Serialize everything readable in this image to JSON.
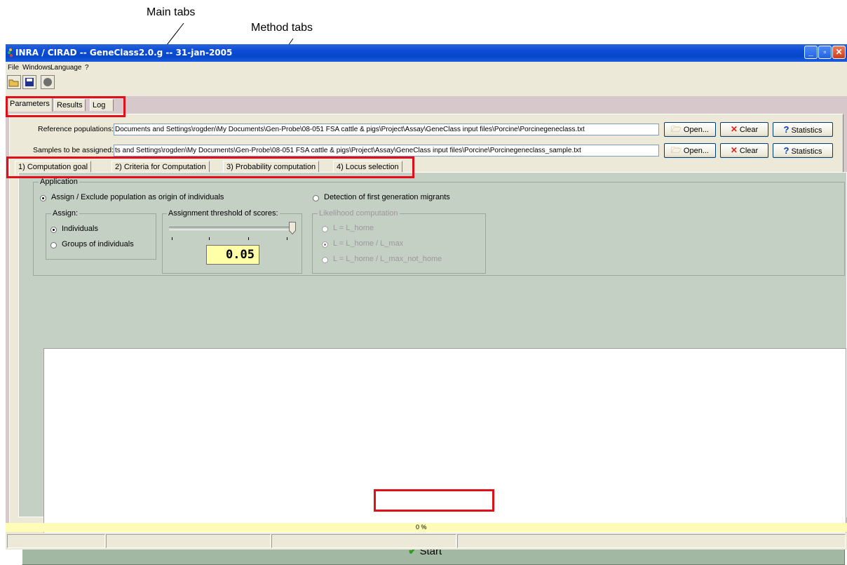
{
  "annotations": {
    "main_tabs_label": "Main tabs",
    "method_tabs_label": "Method tabs"
  },
  "window": {
    "title": "INRA / CIRAD  --  GeneClass2.0.g  --  31-jan-2005",
    "controls": [
      "minimize-icon",
      "restore-icon",
      "close-icon"
    ]
  },
  "menu": {
    "items": [
      {
        "label": "File"
      },
      {
        "label": "Windows"
      },
      {
        "label": "Language"
      },
      {
        "label": "?"
      }
    ]
  },
  "toolbar": {
    "buttons": [
      "open-folder-icon",
      "save-icon",
      "record-icon"
    ]
  },
  "main_tabs": [
    {
      "label": "Parameters",
      "active": true
    },
    {
      "label": "Results",
      "active": false
    },
    {
      "label": "Log",
      "active": false
    }
  ],
  "files": {
    "reference": {
      "label": "Reference populations:",
      "value": "Documents and Settings\\rogden\\My Documents\\Gen-Probe\\08-051 FSA cattle & pigs\\Project\\Assay\\GeneClass input files\\Porcine\\Porcinegeneclass.txt",
      "open_label": "Open...",
      "clear_label": "Clear",
      "stats_label": "Statistics"
    },
    "samples": {
      "label": "Samples to be assigned:",
      "value": "ts and Settings\\rogden\\My Documents\\Gen-Probe\\08-051 FSA cattle & pigs\\Project\\Assay\\GeneClass input files\\Porcine\\Porcinegeneclass_sample.txt",
      "open_label": "Open...",
      "clear_label": "Clear",
      "stats_label": "Statistics"
    }
  },
  "method_tabs": [
    {
      "label": "1) Computation goal",
      "active": true
    },
    {
      "label": "2) Criteria for Computation",
      "active": false
    },
    {
      "label": "3) Probability computation",
      "active": false
    },
    {
      "label": "4) Locus selection",
      "active": false
    }
  ],
  "application": {
    "title": "Application",
    "assign_exclude_label": "Assign / Exclude population as origin of individuals",
    "assign_exclude_selected": true,
    "migrants_label": "Detection of first generation migrants",
    "migrants_selected": false,
    "assign": {
      "title": "Assign:",
      "individuals_label": "Individuals",
      "individuals_selected": true,
      "groups_label": "Groups of individuals",
      "groups_selected": false
    },
    "threshold": {
      "title": "Assignment threshold of scores:",
      "value": "0.05",
      "slider_fraction": 1.0
    },
    "likelihood": {
      "title": "Likelihood computation",
      "options": [
        {
          "label": "L = L_home",
          "selected": false
        },
        {
          "label": "L = L_home / L_max",
          "selected": true
        },
        {
          "label": "L = L_home / L_max_not_home",
          "selected": false
        }
      ]
    }
  },
  "start_label": "Start",
  "progress_text": "0 %",
  "colors": {
    "highlight_box": "#e0101a",
    "titlebar": "#0a4bd6",
    "panel_green": "#c3d0c3",
    "progress_yellow": "#fffcb8",
    "start_check": "#2f9a1f"
  }
}
